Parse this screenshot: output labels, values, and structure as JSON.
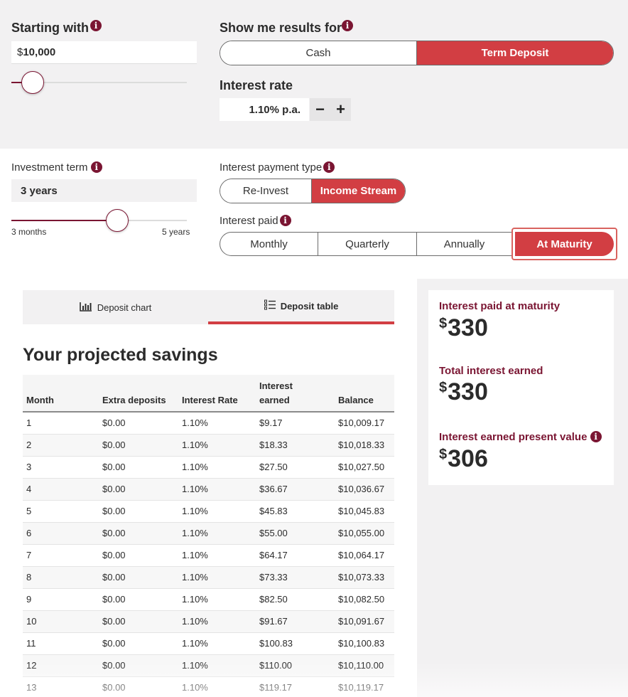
{
  "starting": {
    "label": "Starting with",
    "currency": "$",
    "amount": "10,000",
    "slider_fraction": 0.12
  },
  "results_for": {
    "label": "Show me results for",
    "options": [
      "Cash",
      "Term Deposit"
    ],
    "selected": "Term Deposit"
  },
  "interest_rate": {
    "label": "Interest rate",
    "value": "1.10% p.a.",
    "minus": "−",
    "plus": "+"
  },
  "term": {
    "label": "Investment term",
    "value": "3 years",
    "min_label": "3 months",
    "max_label": "5 years",
    "slider_fraction": 0.6
  },
  "payment_type": {
    "label": "Interest payment type",
    "options": [
      "Re-Invest",
      "Income Stream"
    ],
    "selected": "Income Stream"
  },
  "interest_paid": {
    "label": "Interest paid",
    "options": [
      "Monthly",
      "Quarterly",
      "Annually",
      "At Maturity"
    ],
    "selected": "At Maturity"
  },
  "tabs": {
    "chart": "Deposit chart",
    "table": "Deposit table",
    "active": "Deposit table"
  },
  "projection": {
    "title": "Your projected savings",
    "columns": [
      "Month",
      "Extra deposits",
      "Interest Rate",
      "Interest earned",
      "Balance"
    ],
    "rows": [
      [
        "1",
        "$0.00",
        "1.10%",
        "$9.17",
        "$10,009.17"
      ],
      [
        "2",
        "$0.00",
        "1.10%",
        "$18.33",
        "$10,018.33"
      ],
      [
        "3",
        "$0.00",
        "1.10%",
        "$27.50",
        "$10,027.50"
      ],
      [
        "4",
        "$0.00",
        "1.10%",
        "$36.67",
        "$10,036.67"
      ],
      [
        "5",
        "$0.00",
        "1.10%",
        "$45.83",
        "$10,045.83"
      ],
      [
        "6",
        "$0.00",
        "1.10%",
        "$55.00",
        "$10,055.00"
      ],
      [
        "7",
        "$0.00",
        "1.10%",
        "$64.17",
        "$10,064.17"
      ],
      [
        "8",
        "$0.00",
        "1.10%",
        "$73.33",
        "$10,073.33"
      ],
      [
        "9",
        "$0.00",
        "1.10%",
        "$82.50",
        "$10,082.50"
      ],
      [
        "10",
        "$0.00",
        "1.10%",
        "$91.67",
        "$10,091.67"
      ],
      [
        "11",
        "$0.00",
        "1.10%",
        "$100.83",
        "$10,100.83"
      ],
      [
        "12",
        "$0.00",
        "1.10%",
        "$110.00",
        "$10,110.00"
      ],
      [
        "13",
        "$0.00",
        "1.10%",
        "$119.17",
        "$10,119.17"
      ]
    ]
  },
  "summary": {
    "currency": "$",
    "maturity_label": "Interest paid at maturity",
    "maturity_value": "330",
    "total_label": "Total interest earned",
    "total_value": "330",
    "present_label": "Interest earned present value",
    "present_value": "306"
  },
  "colors": {
    "accent": "#d23e43",
    "brand": "#7a1532",
    "panel": "#f2f1f2"
  },
  "icons": {
    "info": "info-icon",
    "chart": "bar-chart-icon",
    "table": "list-icon"
  }
}
